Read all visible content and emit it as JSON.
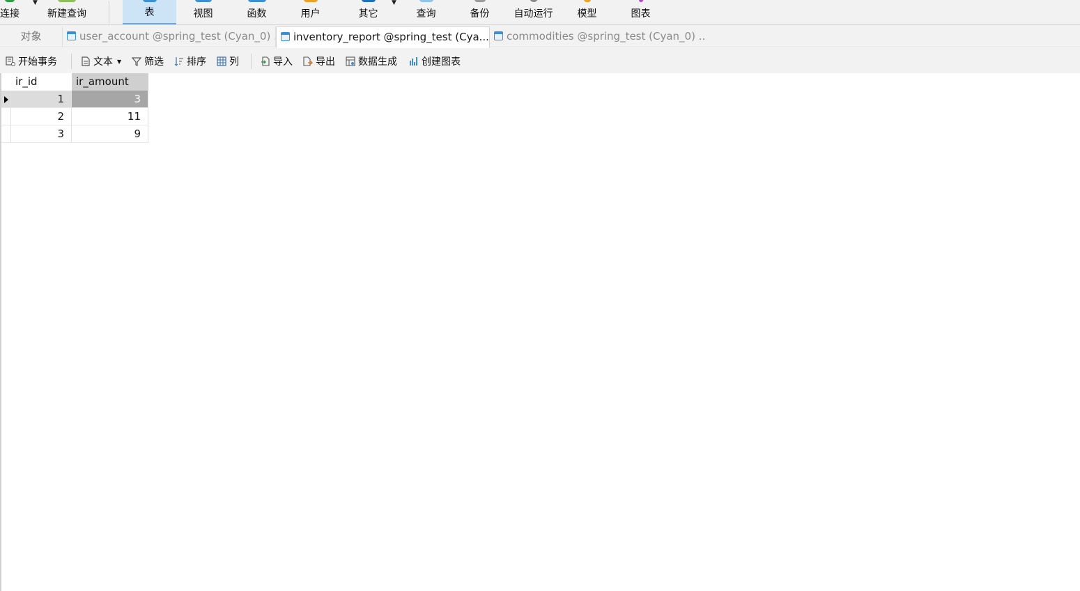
{
  "ribbon": {
    "items": [
      {
        "label": "连接",
        "icon": "connection-icon",
        "color": "#2ea043"
      },
      {
        "label": "新建查询",
        "icon": "new-query-icon",
        "color": "#2ea043"
      },
      {
        "label": "表",
        "icon": "table-icon",
        "color": "#3a8fd6"
      },
      {
        "label": "视图",
        "icon": "view-icon",
        "color": "#3a8fd6"
      },
      {
        "label": "函数",
        "icon": "function-icon",
        "color": "#3a8fd6"
      },
      {
        "label": "用户",
        "icon": "user-icon",
        "color": "#f0a020"
      },
      {
        "label": "其它",
        "icon": "other-icon",
        "color": "#3a8fd6"
      },
      {
        "label": "查询",
        "icon": "query-icon",
        "color": "#3a8fd6"
      },
      {
        "label": "备份",
        "icon": "backup-icon",
        "color": "#888888"
      },
      {
        "label": "自动运行",
        "icon": "automation-icon",
        "color": "#888888"
      },
      {
        "label": "模型",
        "icon": "model-icon",
        "color": "#f0a020"
      },
      {
        "label": "图表",
        "icon": "chart-icon",
        "color": "#b040d0"
      }
    ],
    "active": "表"
  },
  "tabs": {
    "objects_label": "对象",
    "items": [
      {
        "label": "user_account @spring_test (Cyan_0) ..."
      },
      {
        "label": "inventory_report @spring_test (Cya..."
      },
      {
        "label": "commodities @spring_test (Cyan_0) ..."
      }
    ],
    "active_index": 1
  },
  "toolbar": {
    "begin_transaction": "开始事务",
    "text": "文本",
    "filter": "筛选",
    "sort": "排序",
    "columns": "列",
    "import": "导入",
    "export": "导出",
    "data_generation": "数据生成",
    "create_chart": "创建图表"
  },
  "grid": {
    "columns": [
      "ir_id",
      "ir_amount"
    ],
    "rows": [
      [
        "1",
        "3"
      ],
      [
        "2",
        "11"
      ],
      [
        "3",
        "9"
      ]
    ],
    "current_row": 0
  }
}
